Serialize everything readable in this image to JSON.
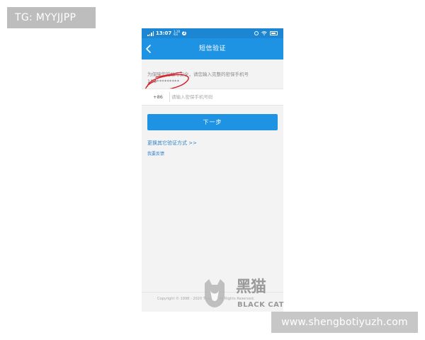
{
  "overlays": {
    "tg_badge": "TG: MYYJJPP",
    "site_badge": "www.shengbotiyuzh.com"
  },
  "status_bar": {
    "time": "13:07",
    "net_speed_value": "1.20",
    "net_speed_unit": "K/s",
    "notification_badge": "2"
  },
  "nav": {
    "title": "短信验证"
  },
  "verify": {
    "hint": "为保障您的帐号安全，请您输入完整的密保手机号",
    "masked_phone": "180*********",
    "country_code": "+86",
    "input_placeholder": "请输入密保手机号码",
    "input_value": "",
    "next_button": "下一步",
    "alt_method_link": "更换其它验证方式 >>",
    "feedback_link": "我要反馈"
  },
  "footer": {
    "copyright": "Copyright © 1998 - 2020 Tencent. All Rights Reserved."
  },
  "watermark": {
    "cn": "黑猫",
    "en": "BLACK CAT"
  },
  "colors": {
    "accent": "#1f93e3",
    "status_bar": "#1d86d2",
    "link": "#2f82c7",
    "scribble": "#d61f2c"
  },
  "icons": {
    "back": "chevron-left-icon",
    "signal": "signal-icon",
    "alarm": "alarm-icon",
    "wifi": "wifi-icon",
    "battery": "battery-icon"
  }
}
